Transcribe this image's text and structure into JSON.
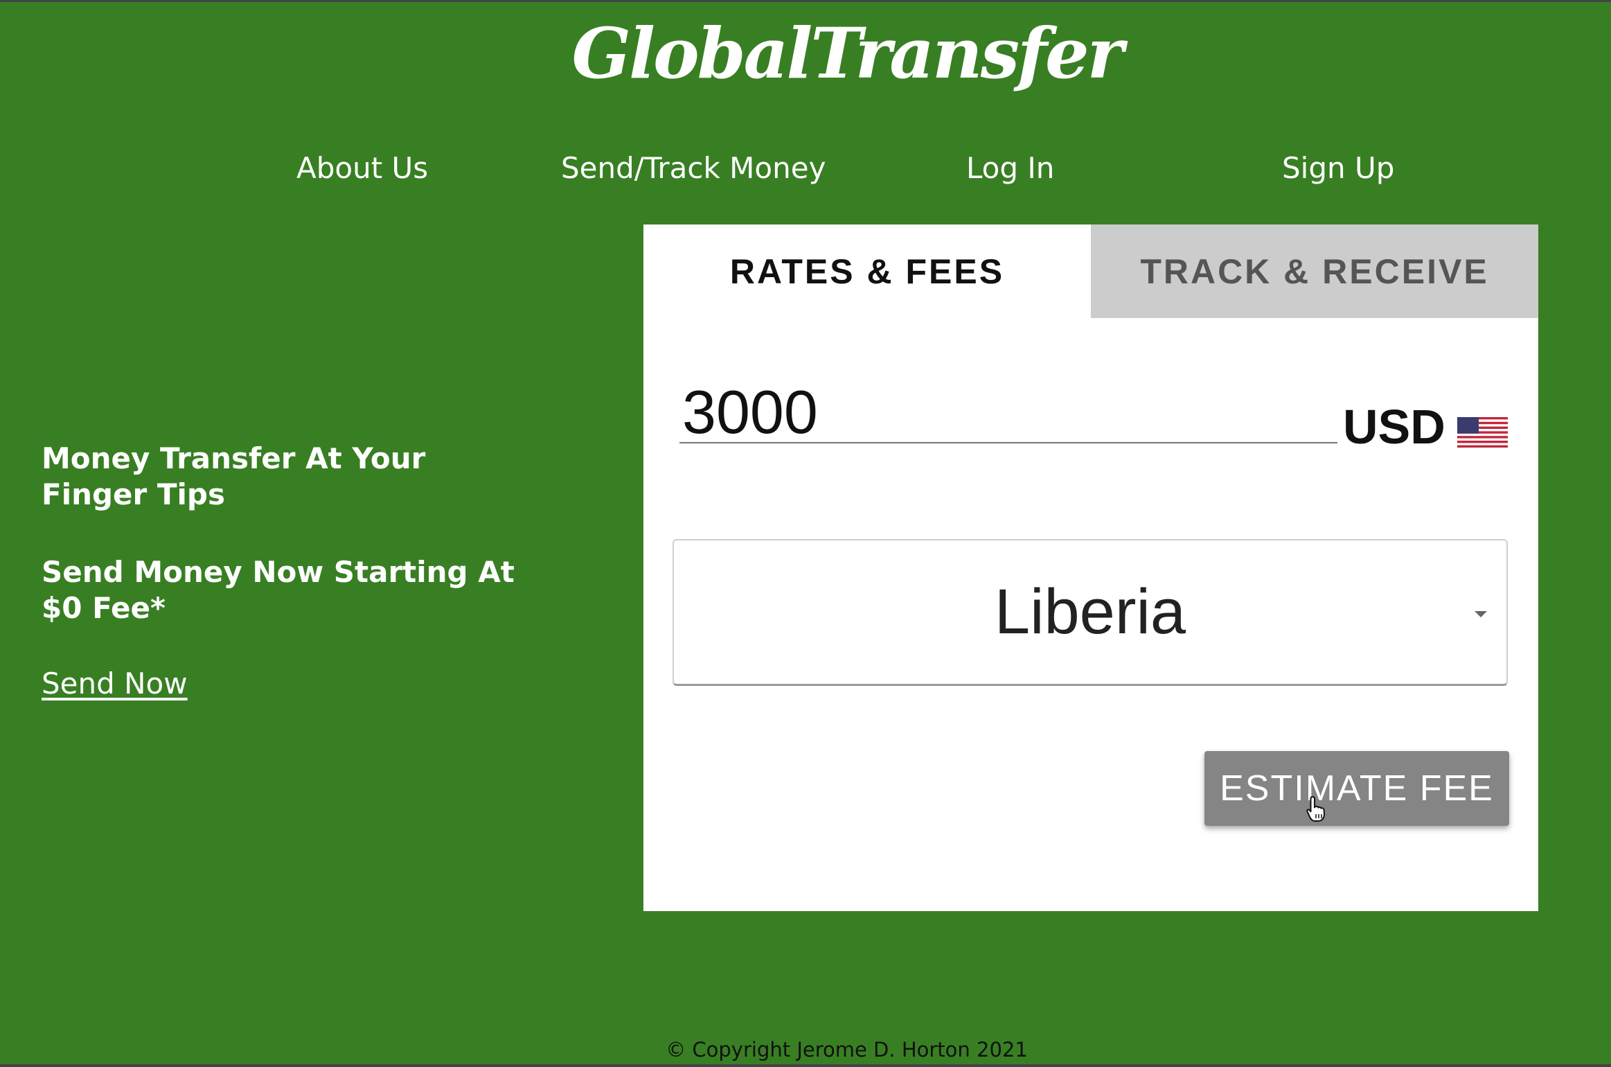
{
  "brand": {
    "logo_text": "GlobalTransfer"
  },
  "nav": {
    "items": [
      {
        "label": "About Us"
      },
      {
        "label": "Send/Track Money"
      },
      {
        "label": "Log In"
      },
      {
        "label": "Sign Up"
      }
    ]
  },
  "hero": {
    "headline": "Money Transfer At Your Finger Tips",
    "subheadline": "Send Money Now Starting At $0 Fee*",
    "cta_label": "Send Now"
  },
  "card": {
    "tabs": [
      {
        "label": "RATES & FEES",
        "active": true
      },
      {
        "label": "TRACK & RECEIVE",
        "active": false
      }
    ],
    "amount_value": "3000",
    "currency": "USD",
    "currency_flag_icon": "us-flag-icon",
    "destination_country": "Liberia",
    "estimate_button_label": "ESTIMATE FEE"
  },
  "footer": {
    "copyright": "© Copyright Jerome D. Horton 2021"
  },
  "colors": {
    "background": "#387f23",
    "card": "#ffffff",
    "inactive_tab": "#cdcccc",
    "button": "#858585"
  }
}
